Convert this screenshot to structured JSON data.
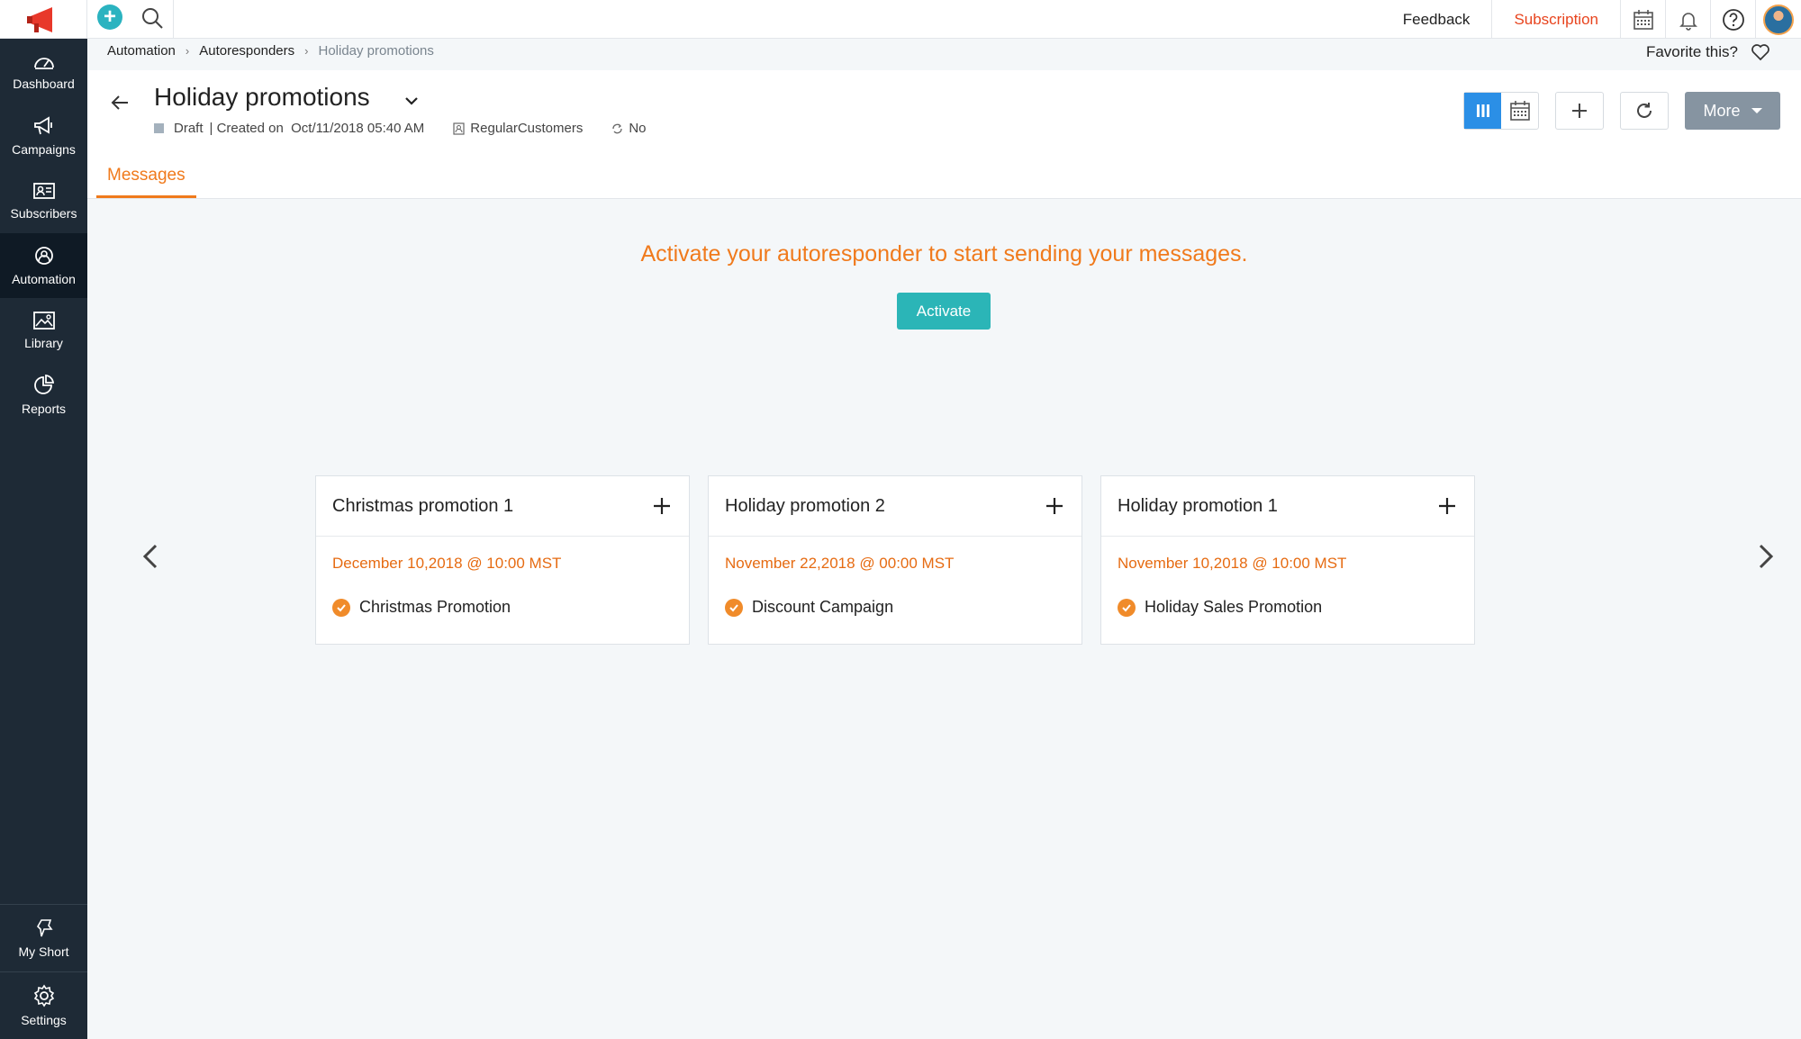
{
  "topbar": {
    "feedback": "Feedback",
    "subscription": "Subscription"
  },
  "sidebar": {
    "items": [
      {
        "label": "Dashboard",
        "icon": "dashboard-icon"
      },
      {
        "label": "Campaigns",
        "icon": "megaphone-icon"
      },
      {
        "label": "Subscribers",
        "icon": "subscribers-icon"
      },
      {
        "label": "Automation",
        "icon": "automation-icon",
        "active": true
      },
      {
        "label": "Library",
        "icon": "image-icon"
      },
      {
        "label": "Reports",
        "icon": "pie-chart-icon"
      }
    ],
    "bottom": [
      {
        "label": "My Short",
        "icon": "pin-icon"
      },
      {
        "label": "Settings",
        "icon": "gear-icon"
      }
    ]
  },
  "breadcrumb": [
    "Automation",
    "Autoresponders",
    "Holiday promotions"
  ],
  "favorite": "Favorite this?",
  "header": {
    "title": "Holiday promotions",
    "status": "Draft",
    "created": "| Created on  Oct/11/2018 05:40 AM",
    "list": "RegularCustomers",
    "recurring": "No",
    "more": "More"
  },
  "tabs": [
    "Messages"
  ],
  "notice": "Activate your autoresponder to start sending your messages.",
  "activate": "Activate",
  "cards": [
    {
      "title": "Christmas promotion 1",
      "date": "December 10,2018 @ 10:00 MST",
      "campaign": "Christmas Promotion"
    },
    {
      "title": "Holiday promotion 2",
      "date": "November 22,2018 @ 00:00 MST",
      "campaign": "Discount Campaign"
    },
    {
      "title": "Holiday promotion 1",
      "date": "November 10,2018 @ 10:00 MST",
      "campaign": "Holiday Sales Promotion"
    }
  ],
  "colors": {
    "accent": "#f07a1c",
    "sidebar": "#1e2a36",
    "activate": "#2bb5b7",
    "subscription": "#e8441e"
  }
}
